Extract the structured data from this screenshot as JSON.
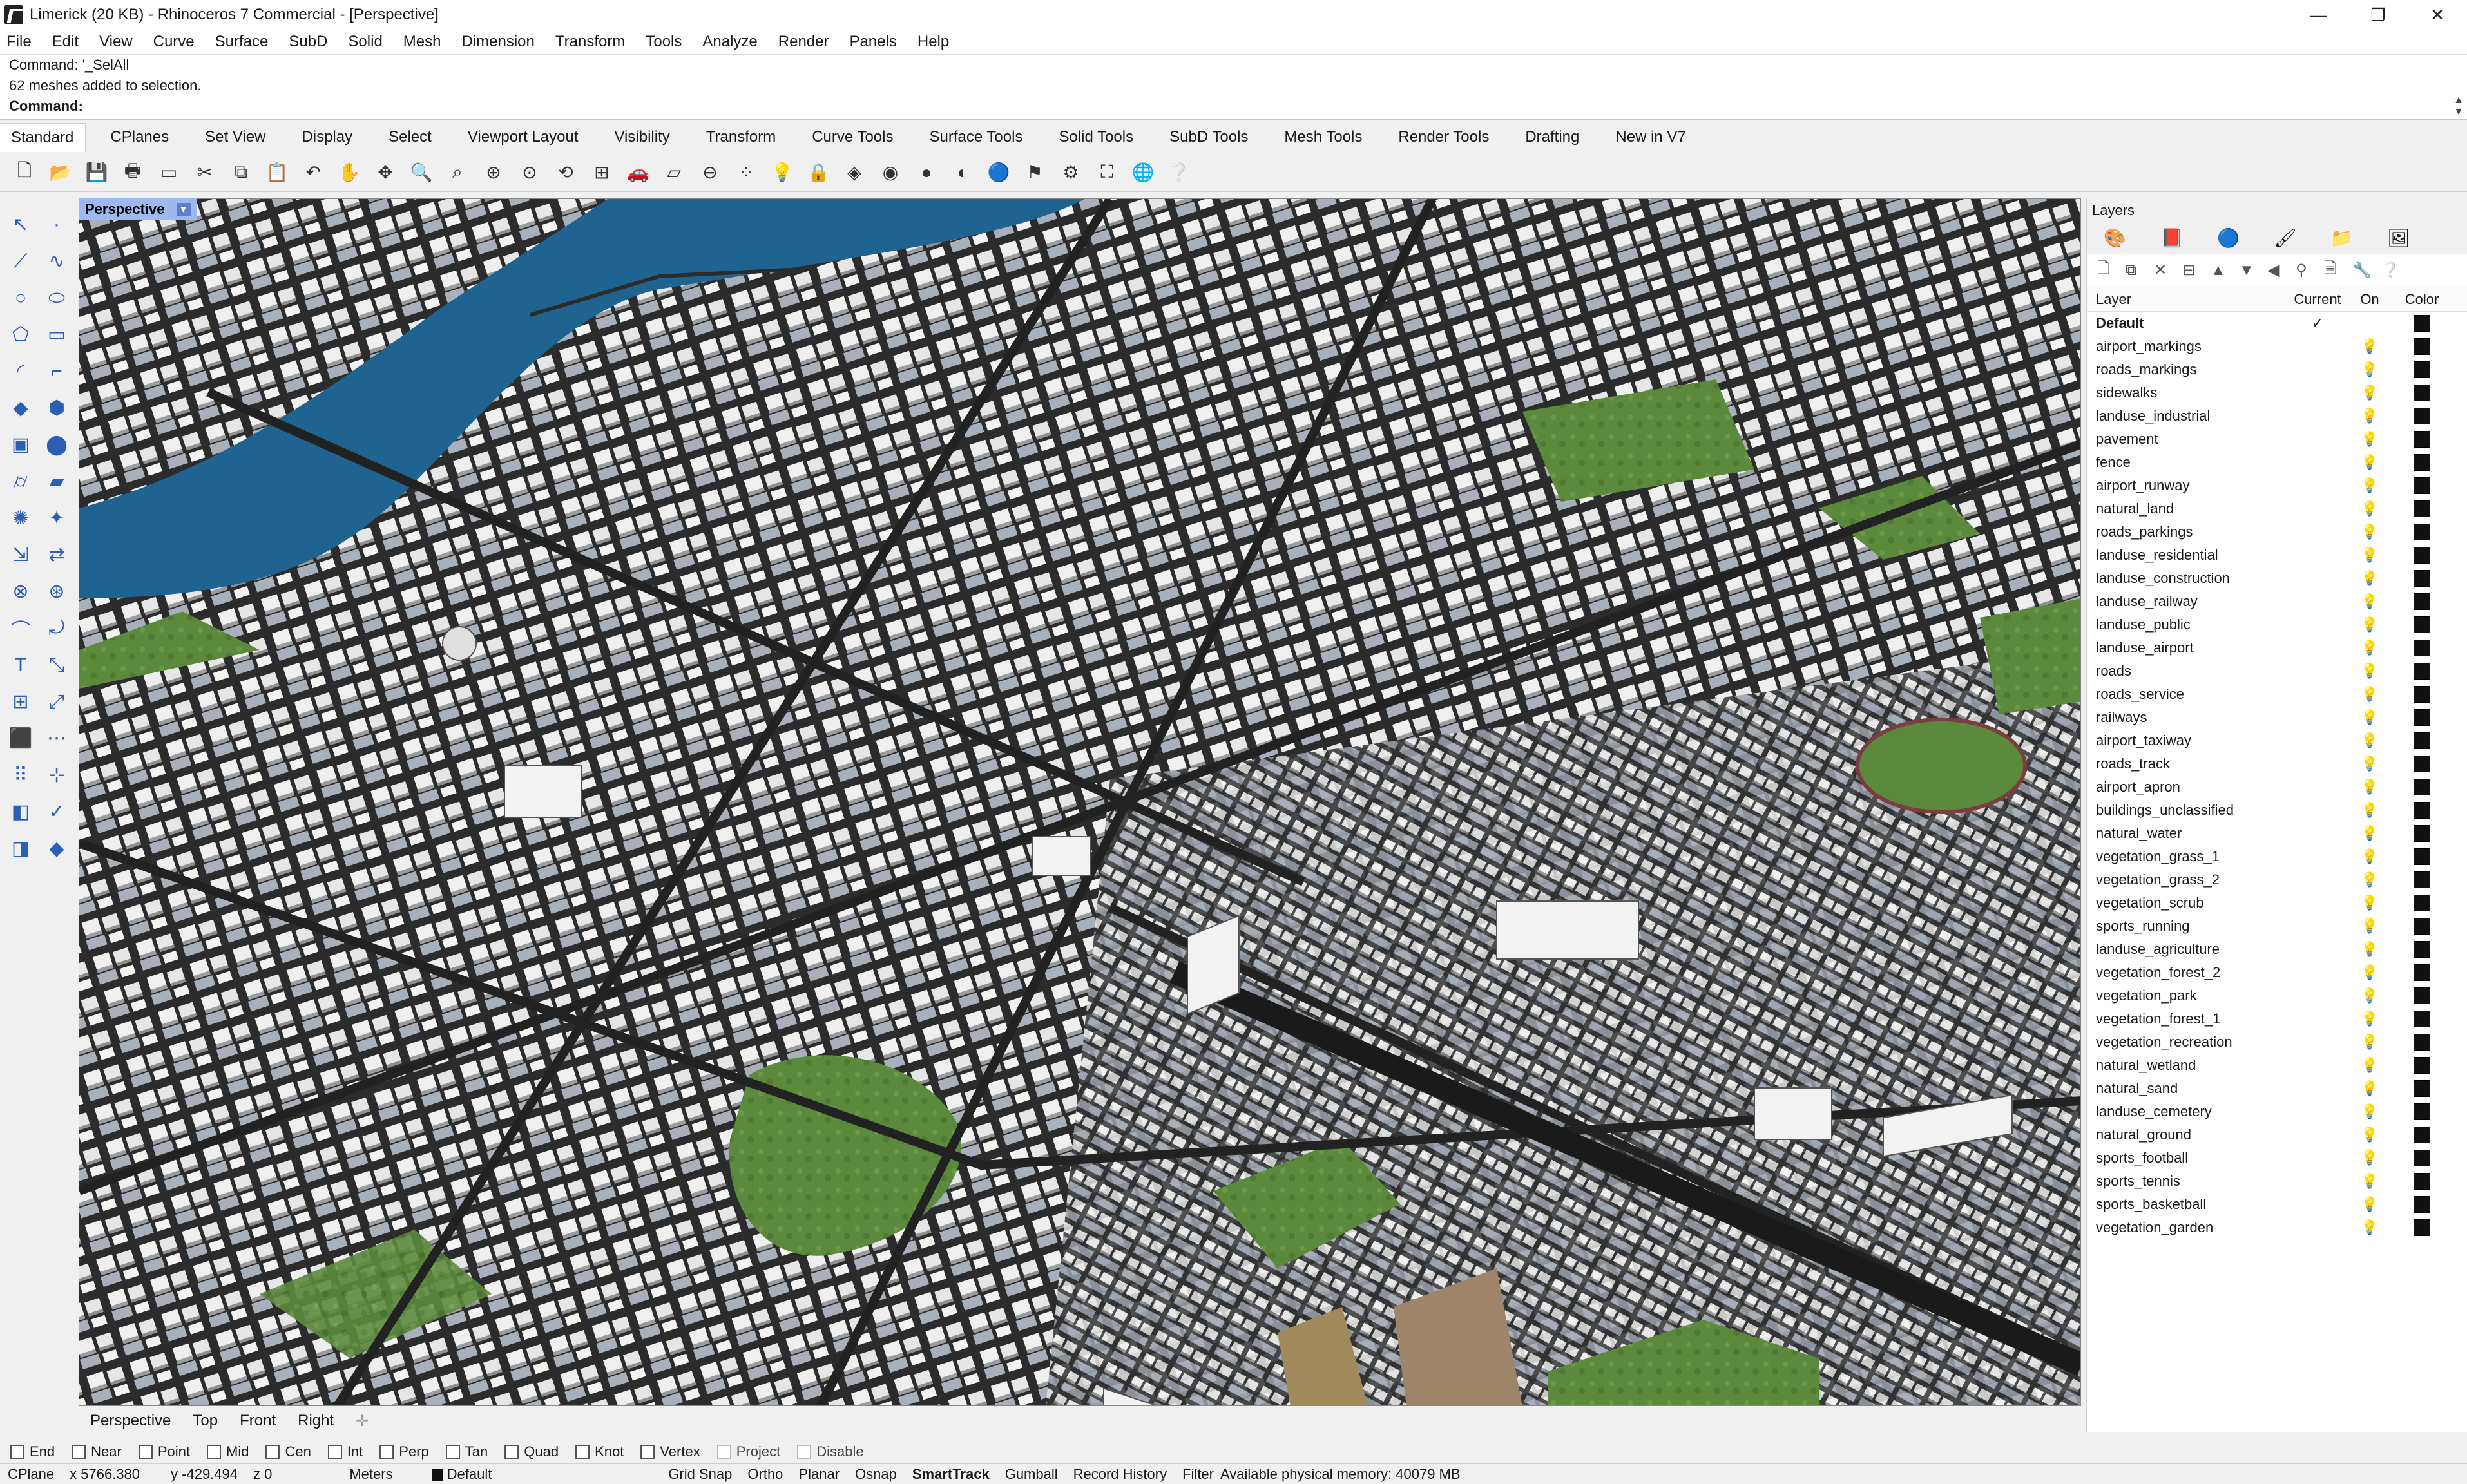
{
  "window": {
    "title": "Limerick (20 KB) - Rhinoceros 7 Commercial - [Perspective]",
    "controls": [
      "—",
      "❐",
      "✕"
    ]
  },
  "menu": [
    "File",
    "Edit",
    "View",
    "Curve",
    "Surface",
    "SubD",
    "Solid",
    "Mesh",
    "Dimension",
    "Transform",
    "Tools",
    "Analyze",
    "Render",
    "Panels",
    "Help"
  ],
  "command": {
    "history_1": "Command: '_SelAll",
    "history_2": "62 meshes added to selection.",
    "prompt": "Command:"
  },
  "tabs": [
    "Standard",
    "CPlanes",
    "Set View",
    "Display",
    "Select",
    "Viewport Layout",
    "Visibility",
    "Transform",
    "Curve Tools",
    "Surface Tools",
    "Solid Tools",
    "SubD Tools",
    "Mesh Tools",
    "Render Tools",
    "Drafting",
    "New in V7"
  ],
  "viewport": {
    "label": "Perspective",
    "view_tabs": [
      "Perspective",
      "Top",
      "Front",
      "Right"
    ]
  },
  "layers_panel": {
    "title": "Layers",
    "columns": {
      "layer": "Layer",
      "current": "Current",
      "on": "On",
      "color": "Color"
    },
    "current_mark": "✓",
    "rows": [
      "Default",
      "airport_markings",
      "roads_markings",
      "sidewalks",
      "landuse_industrial",
      "pavement",
      "fence",
      "airport_runway",
      "natural_land",
      "roads_parkings",
      "landuse_residential",
      "landuse_construction",
      "landuse_railway",
      "landuse_public",
      "landuse_airport",
      "roads",
      "roads_service",
      "railways",
      "airport_taxiway",
      "roads_track",
      "airport_apron",
      "buildings_unclassified",
      "natural_water",
      "vegetation_grass_1",
      "vegetation_grass_2",
      "vegetation_scrub",
      "sports_running",
      "landuse_agriculture",
      "vegetation_forest_2",
      "vegetation_park",
      "vegetation_forest_1",
      "vegetation_recreation",
      "natural_wetland",
      "natural_sand",
      "landuse_cemetery",
      "natural_ground",
      "sports_football",
      "sports_tennis",
      "sports_basketball",
      "vegetation_garden"
    ]
  },
  "osnaps": [
    {
      "label": "End",
      "enabled": true
    },
    {
      "label": "Near",
      "enabled": true
    },
    {
      "label": "Point",
      "enabled": true
    },
    {
      "label": "Mid",
      "enabled": true
    },
    {
      "label": "Cen",
      "enabled": true
    },
    {
      "label": "Int",
      "enabled": true
    },
    {
      "label": "Perp",
      "enabled": true
    },
    {
      "label": "Tan",
      "enabled": true
    },
    {
      "label": "Quad",
      "enabled": true
    },
    {
      "label": "Knot",
      "enabled": true
    },
    {
      "label": "Vertex",
      "enabled": true
    },
    {
      "label": "Project",
      "enabled": false
    },
    {
      "label": "Disable",
      "enabled": false
    }
  ],
  "status": {
    "cplane": "CPlane",
    "x": "x 5766.380",
    "y": "y -429.494",
    "z": "z 0",
    "units": "Meters",
    "layer": "Default",
    "toggles": [
      "Grid Snap",
      "Ortho",
      "Planar",
      "Osnap",
      "SmartTrack",
      "Gumball",
      "Record History",
      "Filter"
    ],
    "memory": "Available physical memory: 40079 MB"
  },
  "colors": {
    "water": "#1f6390",
    "grass": "#5a8a3a",
    "ground": "#8c9199",
    "building": "#ececec",
    "road": "#2e2e2e",
    "viewport_label_bg": "#9db9f0"
  }
}
